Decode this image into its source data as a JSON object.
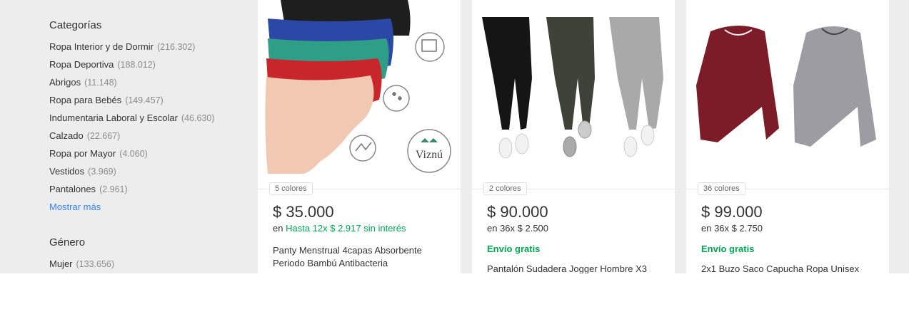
{
  "categories": {
    "title": "Categorías",
    "items": [
      {
        "label": "Ropa Interior y de Dormir",
        "count": "(216.302)"
      },
      {
        "label": "Ropa Deportiva",
        "count": "(188.012)"
      },
      {
        "label": "Abrigos",
        "count": "(11.148)"
      },
      {
        "label": "Ropa para Bebés",
        "count": "(149.457)"
      },
      {
        "label": "Indumentaria Laboral y Escolar",
        "count": "(46.630)"
      },
      {
        "label": "Calzado",
        "count": "(22.667)"
      },
      {
        "label": "Ropa por Mayor",
        "count": "(4.060)"
      },
      {
        "label": "Vestidos",
        "count": "(3.969)"
      },
      {
        "label": "Pantalones",
        "count": "(2.961)"
      }
    ],
    "more": "Mostrar más"
  },
  "gender": {
    "title": "Género",
    "items": [
      {
        "label": "Mujer",
        "count": "(133.656)"
      }
    ]
  },
  "products": [
    {
      "colors": "5 colores",
      "price": "$ 35.000",
      "installments_prefix": "en",
      "installments": "Hasta 12x $ 2.917 sin interés",
      "shipping": "",
      "title": "Panty Menstrual 4capas Absorbente Periodo Bambú Antibacteria",
      "brand_logo": "Viznú"
    },
    {
      "colors": "2 colores",
      "price": "$ 90.000",
      "installments": "en 36x $ 2.500",
      "shipping": "Envío gratis",
      "title": "Pantalón Sudadera Jogger Hombre X3"
    },
    {
      "colors": "36 colores",
      "price": "$ 99.000",
      "installments": "en 36x $ 2.750",
      "shipping": "Envío gratis",
      "title": "2x1 Buzo Saco Capucha Ropa Unisex"
    }
  ]
}
